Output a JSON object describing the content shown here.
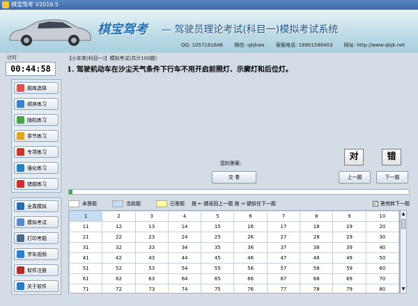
{
  "window": {
    "title": "棋宝驾考 V2016.5"
  },
  "header": {
    "brand": "棋宝驾考",
    "subtitle": "— 驾驶员理论考试(科目一)模拟考试系统",
    "contacts": [
      "QQ: 1057161648",
      "微信: qbjkwx",
      "客服电话: 18901588403",
      "网址: http://www.qbjk.net"
    ]
  },
  "timer": {
    "label": "计时",
    "value": "00:44:58"
  },
  "sidebar": {
    "group1": [
      {
        "label": "题库选择",
        "icon": "book-icon",
        "color": "#d9534f"
      },
      {
        "label": "顺序练习",
        "icon": "list-icon",
        "color": "#3b7fc4"
      },
      {
        "label": "随机练习",
        "icon": "shuffle-icon",
        "color": "#4aa34a"
      },
      {
        "label": "章节练习",
        "icon": "chapter-icon",
        "color": "#e0a526"
      },
      {
        "label": "专项练习",
        "icon": "target-icon",
        "color": "#c0392b"
      },
      {
        "label": "强化练习",
        "icon": "chart-icon",
        "color": "#2a7fbf"
      },
      {
        "label": "错题练习",
        "icon": "flag-icon",
        "color": "#d12f2f"
      }
    ],
    "group2": [
      {
        "label": "全真模拟",
        "icon": "monitor-icon",
        "color": "#2b6cb0"
      },
      {
        "label": "模拟考试",
        "icon": "paper-icon",
        "color": "#5a8ac6"
      },
      {
        "label": "打印考题",
        "icon": "printer-icon",
        "color": "#4d6a8c"
      },
      {
        "label": "学车视频",
        "icon": "video-icon",
        "color": "#2f80c8"
      },
      {
        "label": "软件注册",
        "icon": "key-icon",
        "color": "#b03030"
      },
      {
        "label": "关于软件",
        "icon": "info-icon",
        "color": "#2d7bc0"
      }
    ]
  },
  "question": {
    "header": "【小车类(科目一)】模拟考试(共计100题)",
    "text": "1. 驾驶机动车在沙尘天气条件下行车不用开启前照灯、示廓灯和后位灯。"
  },
  "answer": {
    "label": "您的答案:",
    "correct_label": "对",
    "wrong_label": "错",
    "submit_label": "交  卷"
  },
  "nav": {
    "prev_label": "上一题",
    "next_label": "下一题"
  },
  "progress": {
    "fraction": 0.01
  },
  "legend": {
    "unanswered": "未答题",
    "current": "当前题",
    "answered": "已答题",
    "hint": "按 ← 键返回上一题   按 → 键前往下一题",
    "auto_next": "答完转下一题",
    "colors": {
      "unanswered": "#ffffff",
      "current": "#c5dcf2",
      "answered": "#ffff99"
    }
  },
  "grid": {
    "rows": [
      [
        "1",
        "2",
        "3",
        "4",
        "5",
        "6",
        "7",
        "8",
        "9",
        "10"
      ],
      [
        "11",
        "12",
        "13",
        "14",
        "15",
        "16",
        "17",
        "18",
        "19",
        "20"
      ],
      [
        "21",
        "22",
        "23",
        "24",
        "25",
        "26",
        "27",
        "28",
        "29",
        "30"
      ],
      [
        "31",
        "32",
        "33",
        "34",
        "35",
        "36",
        "37",
        "38",
        "39",
        "40"
      ],
      [
        "41",
        "42",
        "43",
        "44",
        "45",
        "46",
        "47",
        "48",
        "49",
        "50"
      ],
      [
        "51",
        "52",
        "53",
        "54",
        "55",
        "56",
        "57",
        "58",
        "59",
        "60"
      ],
      [
        "61",
        "62",
        "63",
        "64",
        "65",
        "66",
        "67",
        "68",
        "69",
        "70"
      ],
      [
        "71",
        "72",
        "73",
        "74",
        "75",
        "76",
        "77",
        "78",
        "79",
        "80"
      ]
    ]
  }
}
